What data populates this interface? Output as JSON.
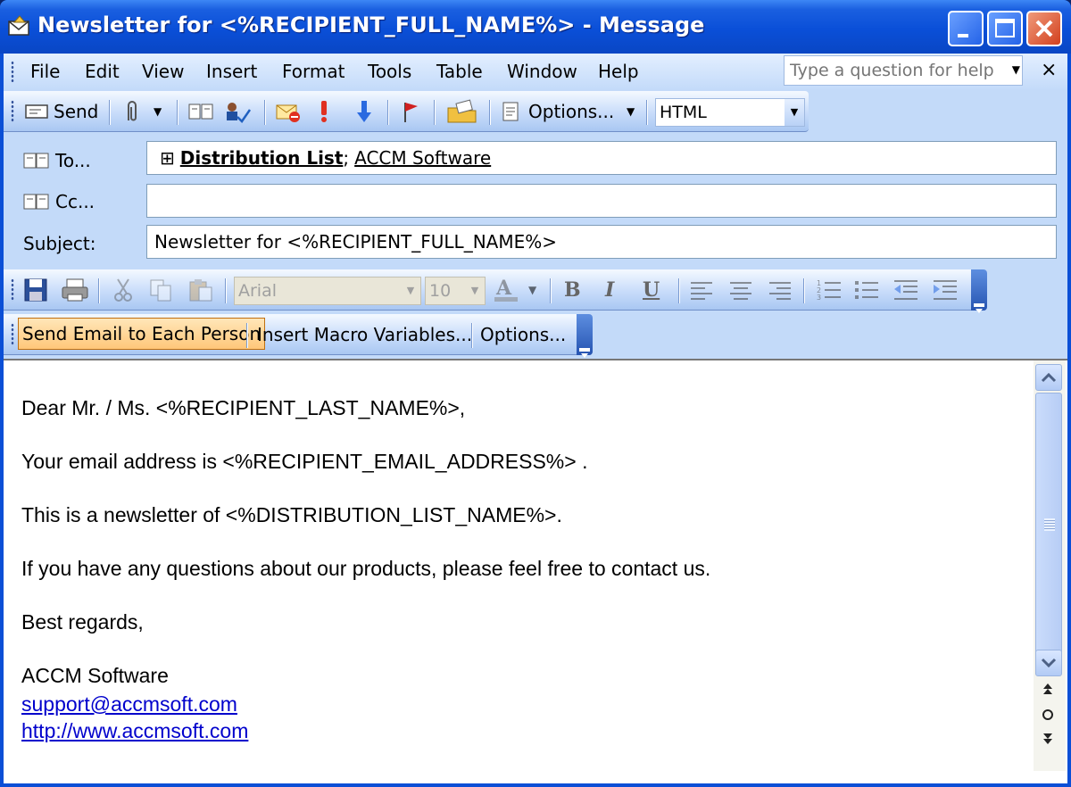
{
  "window": {
    "title": "Newsletter for <%RECIPIENT_FULL_NAME%> - Message"
  },
  "menubar": {
    "items": [
      "File",
      "Edit",
      "View",
      "Insert",
      "Format",
      "Tools",
      "Table",
      "Window",
      "Help"
    ],
    "help_placeholder": "Type a question for help",
    "close_glyph": "×"
  },
  "standard_toolbar": {
    "send_label": "Send",
    "options_label": "Options...",
    "format_value": "HTML"
  },
  "header": {
    "to_label": "To...",
    "cc_label": "Cc...",
    "subject_label": "Subject:",
    "to_expand_glyph": "⊞",
    "to_recipient_1": "Distribution List",
    "to_separator": ";",
    "to_recipient_2": "ACCM Software",
    "cc_value": "",
    "subject_value": "Newsletter for <%RECIPIENT_FULL_NAME%>"
  },
  "formatting_toolbar": {
    "font_value": "Arial",
    "size_value": "10",
    "bold": "B",
    "italic": "I",
    "underline": "U"
  },
  "macro_toolbar": {
    "send_each_label": "Send Email to Each Person",
    "insert_macro_label": "Insert Macro Variables...",
    "options_label": "Options..."
  },
  "body": {
    "line1": "Dear Mr. / Ms. <%RECIPIENT_LAST_NAME%>,",
    "line2": "Your email address is <%RECIPIENT_EMAIL_ADDRESS%> .",
    "line3": "This is a newsletter of <%DISTRIBUTION_LIST_NAME%>.",
    "line4": "If you have any questions about our products, please feel free to contact us.",
    "line5": "Best regards,",
    "signature_name": "ACCM Software",
    "signature_email": "support@accmsoft.com",
    "signature_url": "http://www.accmsoft.com"
  },
  "colors": {
    "titlebar": "#0a4fd8",
    "toolbar": "#c3daf9",
    "link": "#0000cc",
    "highlight_button": "#ffd499"
  }
}
